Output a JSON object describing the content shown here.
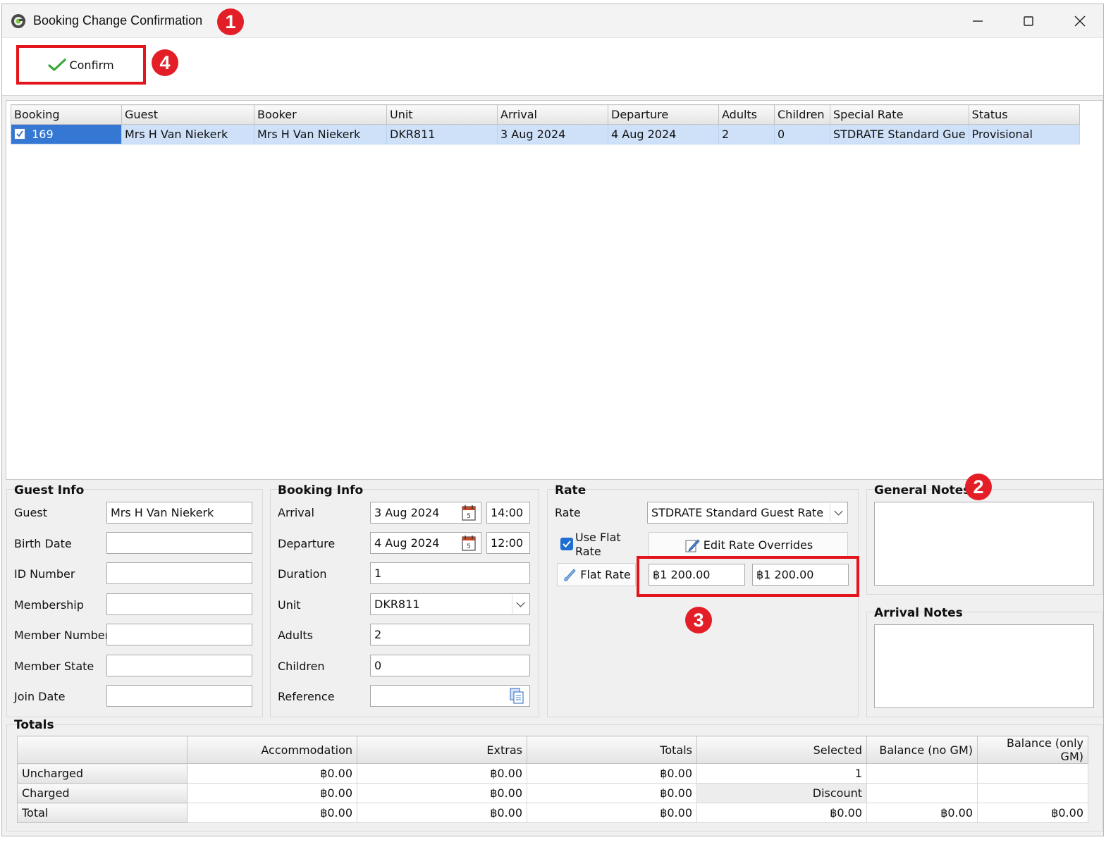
{
  "window": {
    "title": "Booking Change Confirmation"
  },
  "annotations": [
    "1",
    "2",
    "3",
    "4"
  ],
  "toolbar": {
    "confirm_label": "Confirm"
  },
  "bookings": {
    "columns": [
      "Booking",
      "Guest",
      "Booker",
      "Unit",
      "Arrival",
      "Departure",
      "Adults",
      "Children",
      "Special Rate",
      "Status"
    ],
    "row": {
      "booking": "169",
      "guest": "Mrs H Van Niekerk",
      "booker": "Mrs H Van Niekerk",
      "unit": "DKR811",
      "arrival": "3 Aug 2024",
      "departure": "4 Aug 2024",
      "adults": "2",
      "children": "0",
      "special_rate": "STDRATE Standard Gue",
      "status": "Provisional"
    }
  },
  "guest_info": {
    "title": "Guest Info",
    "guest_label": "Guest",
    "guest_value": "Mrs H Van Niekerk",
    "birth_date_label": "Birth Date",
    "birth_date_value": "",
    "id_number_label": "ID Number",
    "id_number_value": "",
    "membership_label": "Membership",
    "membership_value": "",
    "member_number_label": "Member Number",
    "member_number_value": "",
    "member_state_label": "Member State",
    "member_state_value": "",
    "join_date_label": "Join Date",
    "join_date_value": ""
  },
  "booking_info": {
    "title": "Booking Info",
    "arrival_label": "Arrival",
    "arrival_date": "3 Aug 2024",
    "arrival_time": "14:00",
    "departure_label": "Departure",
    "departure_date": "4 Aug 2024",
    "departure_time": "12:00",
    "duration_label": "Duration",
    "duration_value": "1",
    "unit_label": "Unit",
    "unit_value": "DKR811",
    "adults_label": "Adults",
    "adults_value": "2",
    "children_label": "Children",
    "children_value": "0",
    "reference_label": "Reference",
    "reference_value": ""
  },
  "rate": {
    "title": "Rate",
    "rate_label": "Rate",
    "rate_value": "STDRATE Standard Guest Rate",
    "use_flat_rate_line1": "Use Flat",
    "use_flat_rate_line2": "Rate",
    "use_flat_rate_checked": true,
    "edit_overrides_label": "Edit Rate Overrides",
    "flat_rate_button_label": "Flat Rate",
    "flat_rate_value_1": "฿1 200.00",
    "flat_rate_value_2": "฿1 200.00"
  },
  "notes": {
    "general_title": "General Notes",
    "general_value": "",
    "arrival_title": "Arrival Notes",
    "arrival_value": ""
  },
  "totals": {
    "title": "Totals",
    "columns": [
      "",
      "Accommodation",
      "Extras",
      "Totals",
      "Selected",
      "Balance (no GM)",
      "Balance (only GM)"
    ],
    "rows": [
      {
        "label": "Uncharged",
        "accommodation": "฿0.00",
        "extras": "฿0.00",
        "totals": "฿0.00",
        "selected": "1",
        "balance_no_gm": "",
        "balance_only_gm": ""
      },
      {
        "label": "Charged",
        "accommodation": "฿0.00",
        "extras": "฿0.00",
        "totals": "฿0.00",
        "selected": "Discount",
        "balance_no_gm": "",
        "balance_only_gm": ""
      },
      {
        "label": "Total",
        "accommodation": "฿0.00",
        "extras": "฿0.00",
        "totals": "฿0.00",
        "selected": "฿0.00",
        "balance_no_gm": "฿0.00",
        "balance_only_gm": "฿0.00"
      }
    ]
  },
  "colors": {
    "annotation_red": "#e31e26",
    "selection_blue": "#3578d4",
    "row_highlight": "#cfe1f9",
    "check_green": "#3aa63a"
  },
  "icons": [
    "app-logo-icon",
    "minimize-icon",
    "maximize-icon",
    "close-icon",
    "checkmark-icon",
    "calendar-icon",
    "dropdown-arrow-icon",
    "copy-icon",
    "edit-icon",
    "brush-icon"
  ]
}
